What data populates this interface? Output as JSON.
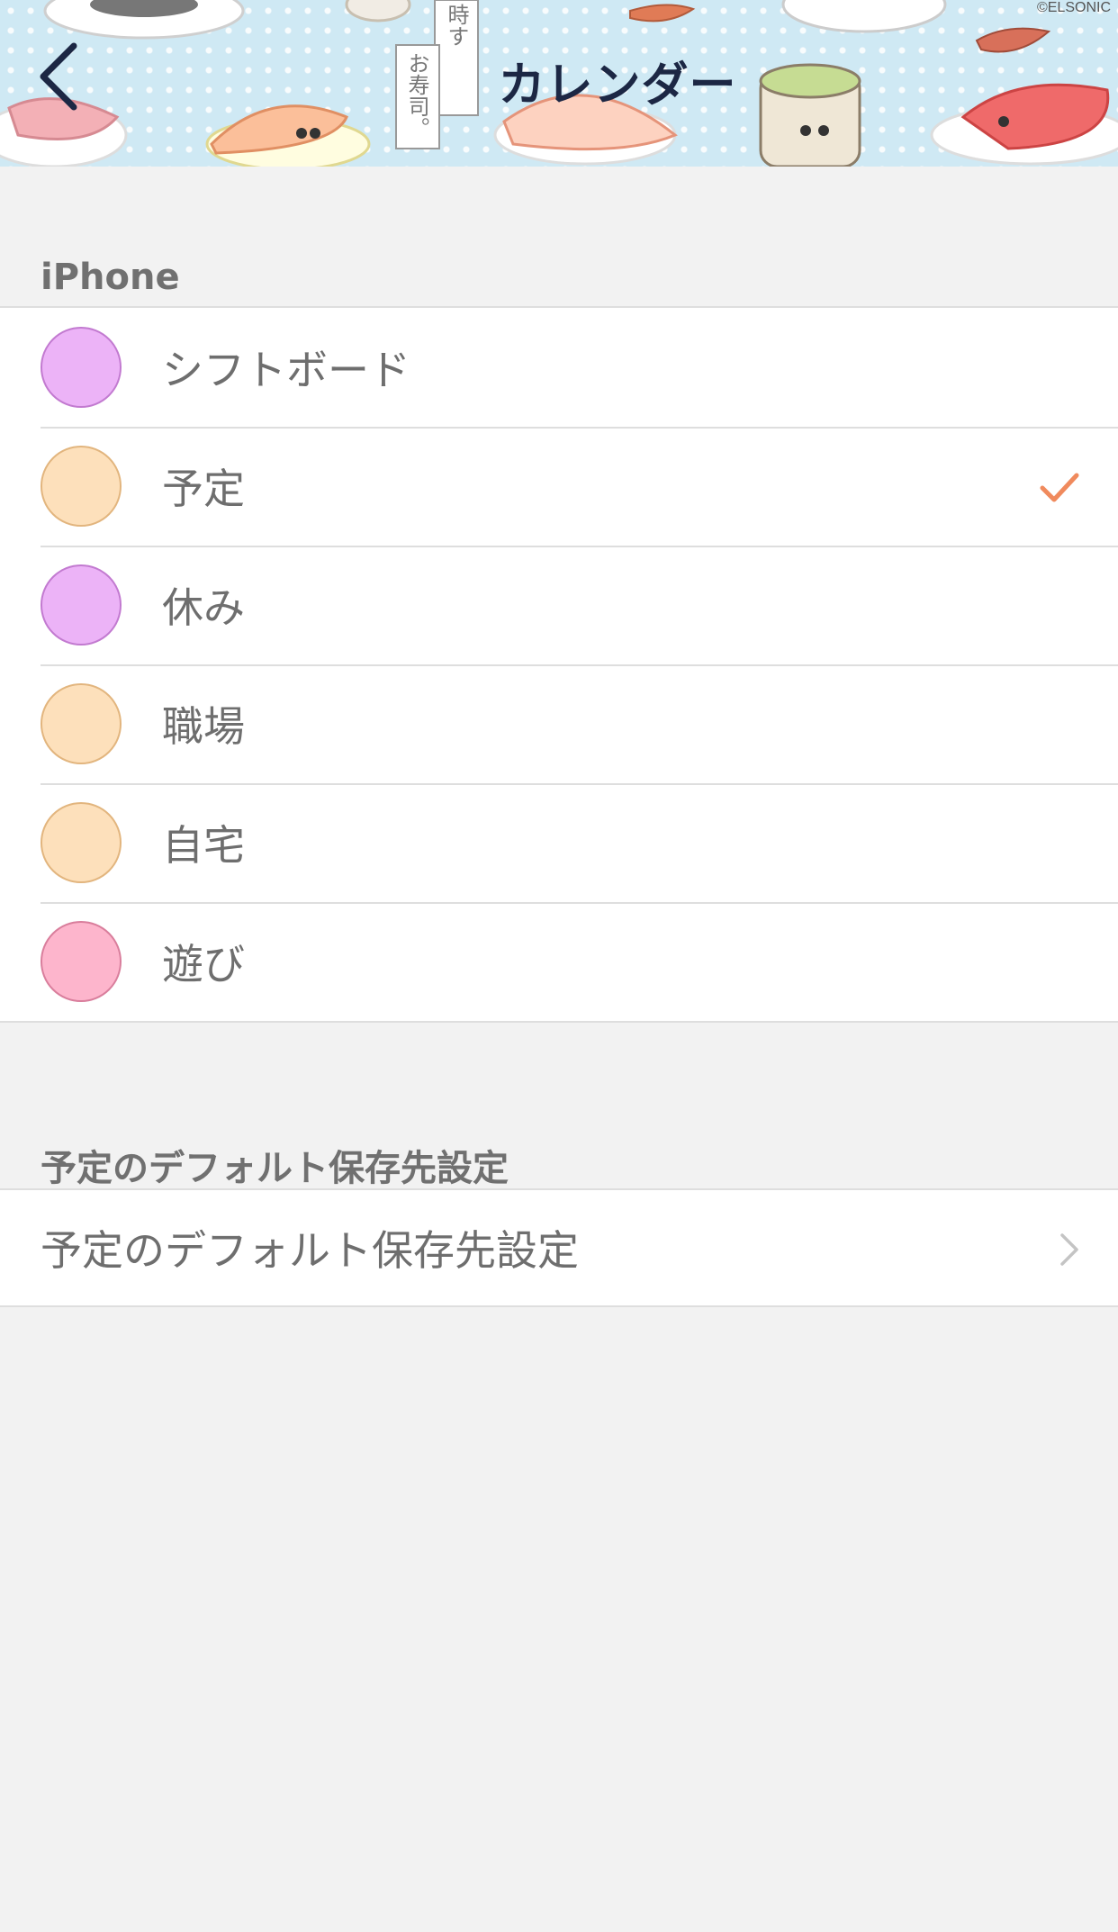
{
  "header": {
    "title": "カレンダー",
    "copyright": "©ELSONIC",
    "banner_text_1": "時す",
    "banner_text_2": "お寿司。"
  },
  "sections": {
    "iphone": {
      "header": "iPhone",
      "calendars": [
        {
          "label": "シフトボード",
          "color": "#ecb3f7",
          "border": "#c27ad0",
          "checked": false
        },
        {
          "label": "予定",
          "color": "#fde0bb",
          "border": "#e2b57e",
          "checked": true
        },
        {
          "label": "休み",
          "color": "#ecb3f7",
          "border": "#c27ad0",
          "checked": false
        },
        {
          "label": "職場",
          "color": "#fde0bb",
          "border": "#e2b57e",
          "checked": false
        },
        {
          "label": "自宅",
          "color": "#fde0bb",
          "border": "#e2b57e",
          "checked": false
        },
        {
          "label": "遊び",
          "color": "#fdb5cc",
          "border": "#d97e9c",
          "checked": false
        }
      ]
    },
    "default": {
      "header": "予定のデフォルト保存先設定",
      "row_label": "予定のデフォルト保存先設定"
    }
  },
  "colors": {
    "accent": "#f08a5d",
    "background": "#f2f2f2",
    "title": "#1c2744"
  }
}
